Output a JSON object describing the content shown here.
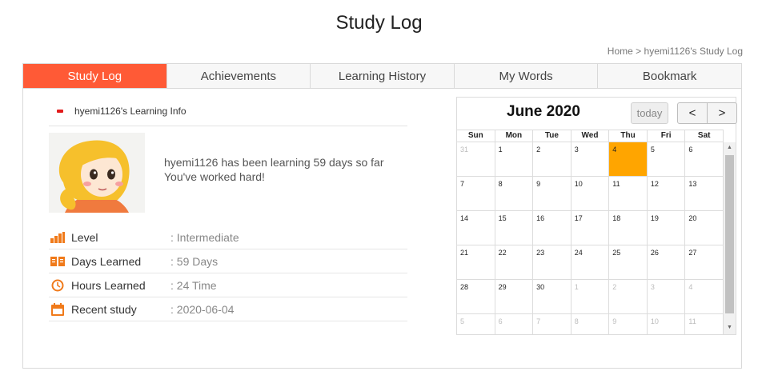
{
  "page": {
    "title": "Study Log"
  },
  "breadcrumb": {
    "home": "Home",
    "sep": ">",
    "current": "hyemi1126's Study Log"
  },
  "tabs": [
    {
      "label": "Study Log",
      "active": true
    },
    {
      "label": "Achievements"
    },
    {
      "label": "Learning History"
    },
    {
      "label": "My Words"
    },
    {
      "label": "Bookmark"
    }
  ],
  "info": {
    "heading": "hyemi1126's Learning Info",
    "line1": "hyemi1126 has been learning 59 days so far",
    "line2": "You've worked hard!"
  },
  "stats": [
    {
      "icon": "bar-chart-icon",
      "label": "Level",
      "value": ": Intermediate"
    },
    {
      "icon": "book-icon",
      "label": "Days Learned",
      "value": ": 59 Days"
    },
    {
      "icon": "clock-icon",
      "label": "Hours Learned",
      "value": ": 24 Time"
    },
    {
      "icon": "calendar-day-icon",
      "label": "Recent study",
      "value": ": 2020-06-04"
    }
  ],
  "calendar": {
    "title": "June 2020",
    "today_label": "today",
    "prev": "<",
    "next": ">",
    "weekdays": [
      "Sun",
      "Mon",
      "Tue",
      "Wed",
      "Thu",
      "Fri",
      "Sat"
    ],
    "days": [
      {
        "d": "31",
        "other": true
      },
      {
        "d": "1"
      },
      {
        "d": "2"
      },
      {
        "d": "3"
      },
      {
        "d": "4",
        "today": true
      },
      {
        "d": "5"
      },
      {
        "d": "6"
      },
      {
        "d": "7"
      },
      {
        "d": "8"
      },
      {
        "d": "9"
      },
      {
        "d": "10"
      },
      {
        "d": "11"
      },
      {
        "d": "12"
      },
      {
        "d": "13"
      },
      {
        "d": "14"
      },
      {
        "d": "15"
      },
      {
        "d": "16"
      },
      {
        "d": "17"
      },
      {
        "d": "18"
      },
      {
        "d": "19"
      },
      {
        "d": "20"
      },
      {
        "d": "21"
      },
      {
        "d": "22"
      },
      {
        "d": "23"
      },
      {
        "d": "24"
      },
      {
        "d": "25"
      },
      {
        "d": "26"
      },
      {
        "d": "27"
      },
      {
        "d": "28"
      },
      {
        "d": "29"
      },
      {
        "d": "30"
      },
      {
        "d": "1",
        "other": true
      },
      {
        "d": "2",
        "other": true
      },
      {
        "d": "3",
        "other": true
      },
      {
        "d": "4",
        "other": true
      },
      {
        "d": "5",
        "other": true
      },
      {
        "d": "6",
        "other": true
      },
      {
        "d": "7",
        "other": true
      },
      {
        "d": "8",
        "other": true
      },
      {
        "d": "9",
        "other": true
      },
      {
        "d": "10",
        "other": true
      },
      {
        "d": "11",
        "other": true
      }
    ]
  },
  "colors": {
    "accent": "#ff5a36",
    "today": "#ffa500",
    "marker": "#e21b1b"
  }
}
